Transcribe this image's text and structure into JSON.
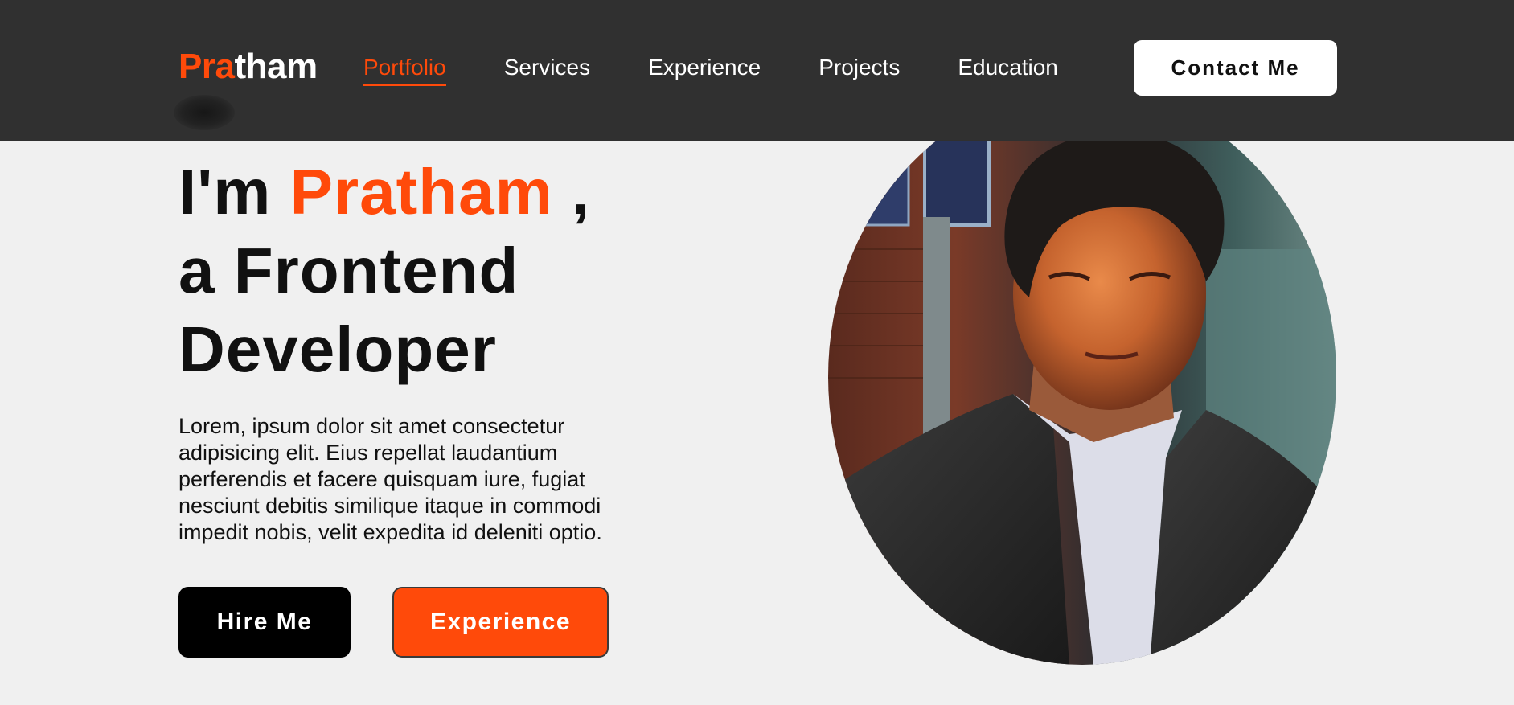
{
  "brand": {
    "accent_part": "Pra",
    "rest_part": "tham",
    "accent_color": "#ff4a0a"
  },
  "nav": {
    "items": [
      {
        "label": "Portfolio",
        "active": true
      },
      {
        "label": "Services",
        "active": false
      },
      {
        "label": "Experience",
        "active": false
      },
      {
        "label": "Projects",
        "active": false
      },
      {
        "label": "Education",
        "active": false
      }
    ],
    "contact_label": "Contact Me"
  },
  "hero": {
    "greeting": "I'm",
    "name": "Pratham",
    "comma": ",",
    "role_line1": "a Frontend",
    "role_line2": "Developer",
    "description": "Lorem, ipsum dolor sit amet consectetur adipisicing elit. Eius repellat laudantium perferendis et facere quisquam iure, fugiat nesciunt debitis similique itaque in commodi impedit nobis, velit expedita id deleniti optio.",
    "hire_label": "Hire Me",
    "experience_label": "Experience"
  },
  "colors": {
    "navbar_bg": "#303030",
    "page_bg": "#f0f0f0",
    "accent": "#ff4a0a",
    "dark_button": "#000000"
  }
}
